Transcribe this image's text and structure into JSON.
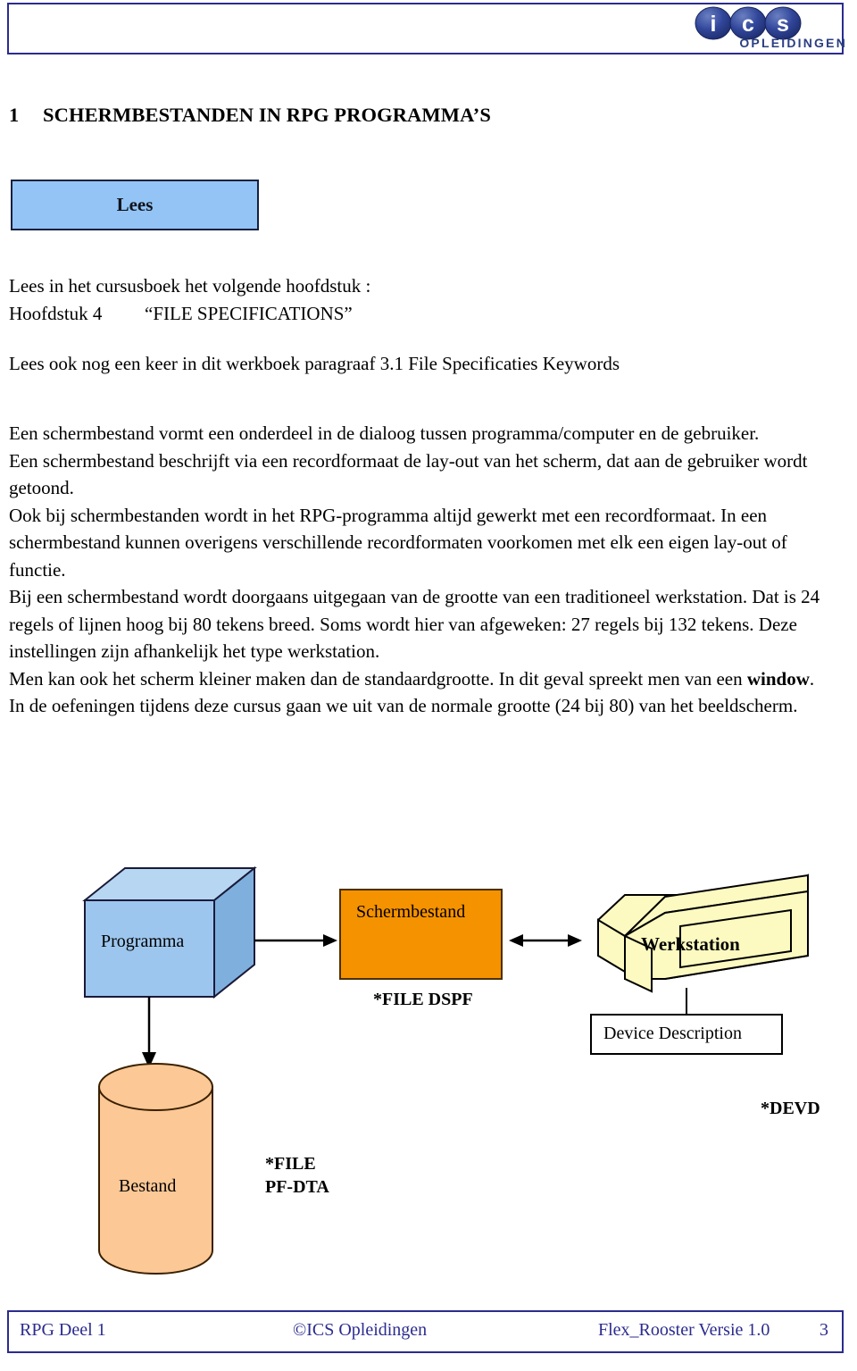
{
  "header": {
    "logo": {
      "letters": [
        "i",
        "c",
        "s"
      ],
      "subtitle": "OPLEIDINGEN",
      "brand_color": "#2b3f82",
      "border_color": "#2b2b8f"
    }
  },
  "chapter": {
    "number": "1",
    "title": "SCHERMBESTANDEN IN RPG PROGRAMMA’S"
  },
  "callout": {
    "label": "Lees",
    "fill_color": "#93c4f5",
    "border_color": "#16213e"
  },
  "read_block": {
    "line1": "Lees in het cursusboek het volgende hoofdstuk :",
    "line2_label": "Hoofdstuk 4",
    "line2_value": "“FILE SPECIFICATIONS”",
    "line3": "Lees ook nog een keer in dit werkboek paragraaf  3.1  File Specificaties Keywords"
  },
  "body": {
    "paragraphs": [
      "Een schermbestand vormt een onderdeel in de dialoog tussen programma/computer en de gebruiker.",
      "Een schermbestand  beschrijft via een recordformaat de lay-out van het scherm, dat aan de gebruiker wordt getoond.",
      "Ook bij schermbestanden wordt in het RPG-programma altijd gewerkt met een recordformaat. In een schermbestand kunnen overigens verschillende recordformaten voorkomen met elk een eigen lay-out of functie.",
      "Bij een schermbestand wordt doorgaans uitgegaan van de grootte van een traditioneel werkstation. Dat is 24 regels of lijnen hoog bij 80 tekens breed. Soms wordt hier van afgeweken: 27 regels bij 132 tekens. Deze instellingen zijn afhankelijk het type werkstation."
    ],
    "window_sentence_pre": "Men kan ook het scherm kleiner maken dan de standaardgrootte. In dit geval spreekt men van een ",
    "window_sentence_bold": "window",
    "window_sentence_post": ".",
    "last_paragraph": "In de oefeningen tijdens deze cursus gaan we uit van de normale grootte (24 bij 80) van het beeldscherm."
  },
  "diagram": {
    "program_label": "Programma",
    "program_color": "#9dc6ee",
    "display_file_label": "Schermbestand",
    "display_file_color": "#f59200",
    "display_file_tag": "*FILE DSPF",
    "workstation_label": "Werkstation",
    "workstation_color": "#fcfac0",
    "device_description_label": "Device Description",
    "device_description_tag": "*DEVD",
    "database_label": "Bestand",
    "database_color": "#fbc896",
    "database_tag_line1": "*FILE",
    "database_tag_line2": "PF-DTA"
  },
  "footer": {
    "left": "RPG Deel 1",
    "center": "©ICS Opleidingen",
    "right": "Flex_Rooster  Versie 1.0",
    "page": "3",
    "color": "#2b2b8f"
  }
}
